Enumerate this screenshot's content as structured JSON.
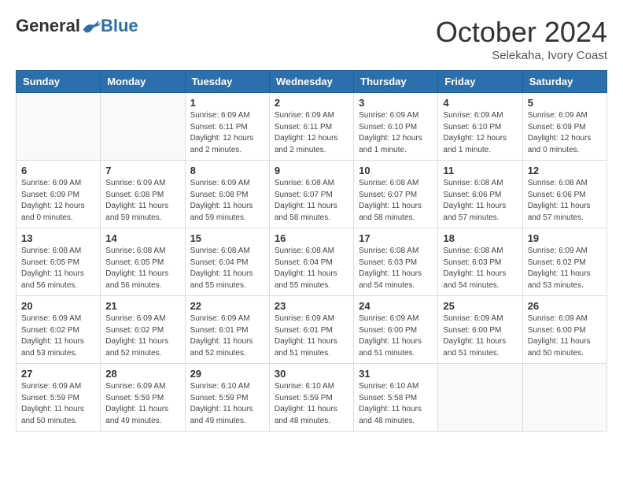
{
  "logo": {
    "general": "General",
    "blue": "Blue"
  },
  "title": "October 2024",
  "subtitle": "Selekaha, Ivory Coast",
  "weekdays": [
    "Sunday",
    "Monday",
    "Tuesday",
    "Wednesday",
    "Thursday",
    "Friday",
    "Saturday"
  ],
  "weeks": [
    [
      {
        "day": "",
        "info": ""
      },
      {
        "day": "",
        "info": ""
      },
      {
        "day": "1",
        "info": "Sunrise: 6:09 AM\nSunset: 6:11 PM\nDaylight: 12 hours\nand 2 minutes."
      },
      {
        "day": "2",
        "info": "Sunrise: 6:09 AM\nSunset: 6:11 PM\nDaylight: 12 hours\nand 2 minutes."
      },
      {
        "day": "3",
        "info": "Sunrise: 6:09 AM\nSunset: 6:10 PM\nDaylight: 12 hours\nand 1 minute."
      },
      {
        "day": "4",
        "info": "Sunrise: 6:09 AM\nSunset: 6:10 PM\nDaylight: 12 hours\nand 1 minute."
      },
      {
        "day": "5",
        "info": "Sunrise: 6:09 AM\nSunset: 6:09 PM\nDaylight: 12 hours\nand 0 minutes."
      }
    ],
    [
      {
        "day": "6",
        "info": "Sunrise: 6:09 AM\nSunset: 6:09 PM\nDaylight: 12 hours\nand 0 minutes."
      },
      {
        "day": "7",
        "info": "Sunrise: 6:09 AM\nSunset: 6:08 PM\nDaylight: 11 hours\nand 59 minutes."
      },
      {
        "day": "8",
        "info": "Sunrise: 6:09 AM\nSunset: 6:08 PM\nDaylight: 11 hours\nand 59 minutes."
      },
      {
        "day": "9",
        "info": "Sunrise: 6:08 AM\nSunset: 6:07 PM\nDaylight: 11 hours\nand 58 minutes."
      },
      {
        "day": "10",
        "info": "Sunrise: 6:08 AM\nSunset: 6:07 PM\nDaylight: 11 hours\nand 58 minutes."
      },
      {
        "day": "11",
        "info": "Sunrise: 6:08 AM\nSunset: 6:06 PM\nDaylight: 11 hours\nand 57 minutes."
      },
      {
        "day": "12",
        "info": "Sunrise: 6:08 AM\nSunset: 6:06 PM\nDaylight: 11 hours\nand 57 minutes."
      }
    ],
    [
      {
        "day": "13",
        "info": "Sunrise: 6:08 AM\nSunset: 6:05 PM\nDaylight: 11 hours\nand 56 minutes."
      },
      {
        "day": "14",
        "info": "Sunrise: 6:08 AM\nSunset: 6:05 PM\nDaylight: 11 hours\nand 56 minutes."
      },
      {
        "day": "15",
        "info": "Sunrise: 6:08 AM\nSunset: 6:04 PM\nDaylight: 11 hours\nand 55 minutes."
      },
      {
        "day": "16",
        "info": "Sunrise: 6:08 AM\nSunset: 6:04 PM\nDaylight: 11 hours\nand 55 minutes."
      },
      {
        "day": "17",
        "info": "Sunrise: 6:08 AM\nSunset: 6:03 PM\nDaylight: 11 hours\nand 54 minutes."
      },
      {
        "day": "18",
        "info": "Sunrise: 6:08 AM\nSunset: 6:03 PM\nDaylight: 11 hours\nand 54 minutes."
      },
      {
        "day": "19",
        "info": "Sunrise: 6:09 AM\nSunset: 6:02 PM\nDaylight: 11 hours\nand 53 minutes."
      }
    ],
    [
      {
        "day": "20",
        "info": "Sunrise: 6:09 AM\nSunset: 6:02 PM\nDaylight: 11 hours\nand 53 minutes."
      },
      {
        "day": "21",
        "info": "Sunrise: 6:09 AM\nSunset: 6:02 PM\nDaylight: 11 hours\nand 52 minutes."
      },
      {
        "day": "22",
        "info": "Sunrise: 6:09 AM\nSunset: 6:01 PM\nDaylight: 11 hours\nand 52 minutes."
      },
      {
        "day": "23",
        "info": "Sunrise: 6:09 AM\nSunset: 6:01 PM\nDaylight: 11 hours\nand 51 minutes."
      },
      {
        "day": "24",
        "info": "Sunrise: 6:09 AM\nSunset: 6:00 PM\nDaylight: 11 hours\nand 51 minutes."
      },
      {
        "day": "25",
        "info": "Sunrise: 6:09 AM\nSunset: 6:00 PM\nDaylight: 11 hours\nand 51 minutes."
      },
      {
        "day": "26",
        "info": "Sunrise: 6:09 AM\nSunset: 6:00 PM\nDaylight: 11 hours\nand 50 minutes."
      }
    ],
    [
      {
        "day": "27",
        "info": "Sunrise: 6:09 AM\nSunset: 5:59 PM\nDaylight: 11 hours\nand 50 minutes."
      },
      {
        "day": "28",
        "info": "Sunrise: 6:09 AM\nSunset: 5:59 PM\nDaylight: 11 hours\nand 49 minutes."
      },
      {
        "day": "29",
        "info": "Sunrise: 6:10 AM\nSunset: 5:59 PM\nDaylight: 11 hours\nand 49 minutes."
      },
      {
        "day": "30",
        "info": "Sunrise: 6:10 AM\nSunset: 5:59 PM\nDaylight: 11 hours\nand 48 minutes."
      },
      {
        "day": "31",
        "info": "Sunrise: 6:10 AM\nSunset: 5:58 PM\nDaylight: 11 hours\nand 48 minutes."
      },
      {
        "day": "",
        "info": ""
      },
      {
        "day": "",
        "info": ""
      }
    ]
  ]
}
